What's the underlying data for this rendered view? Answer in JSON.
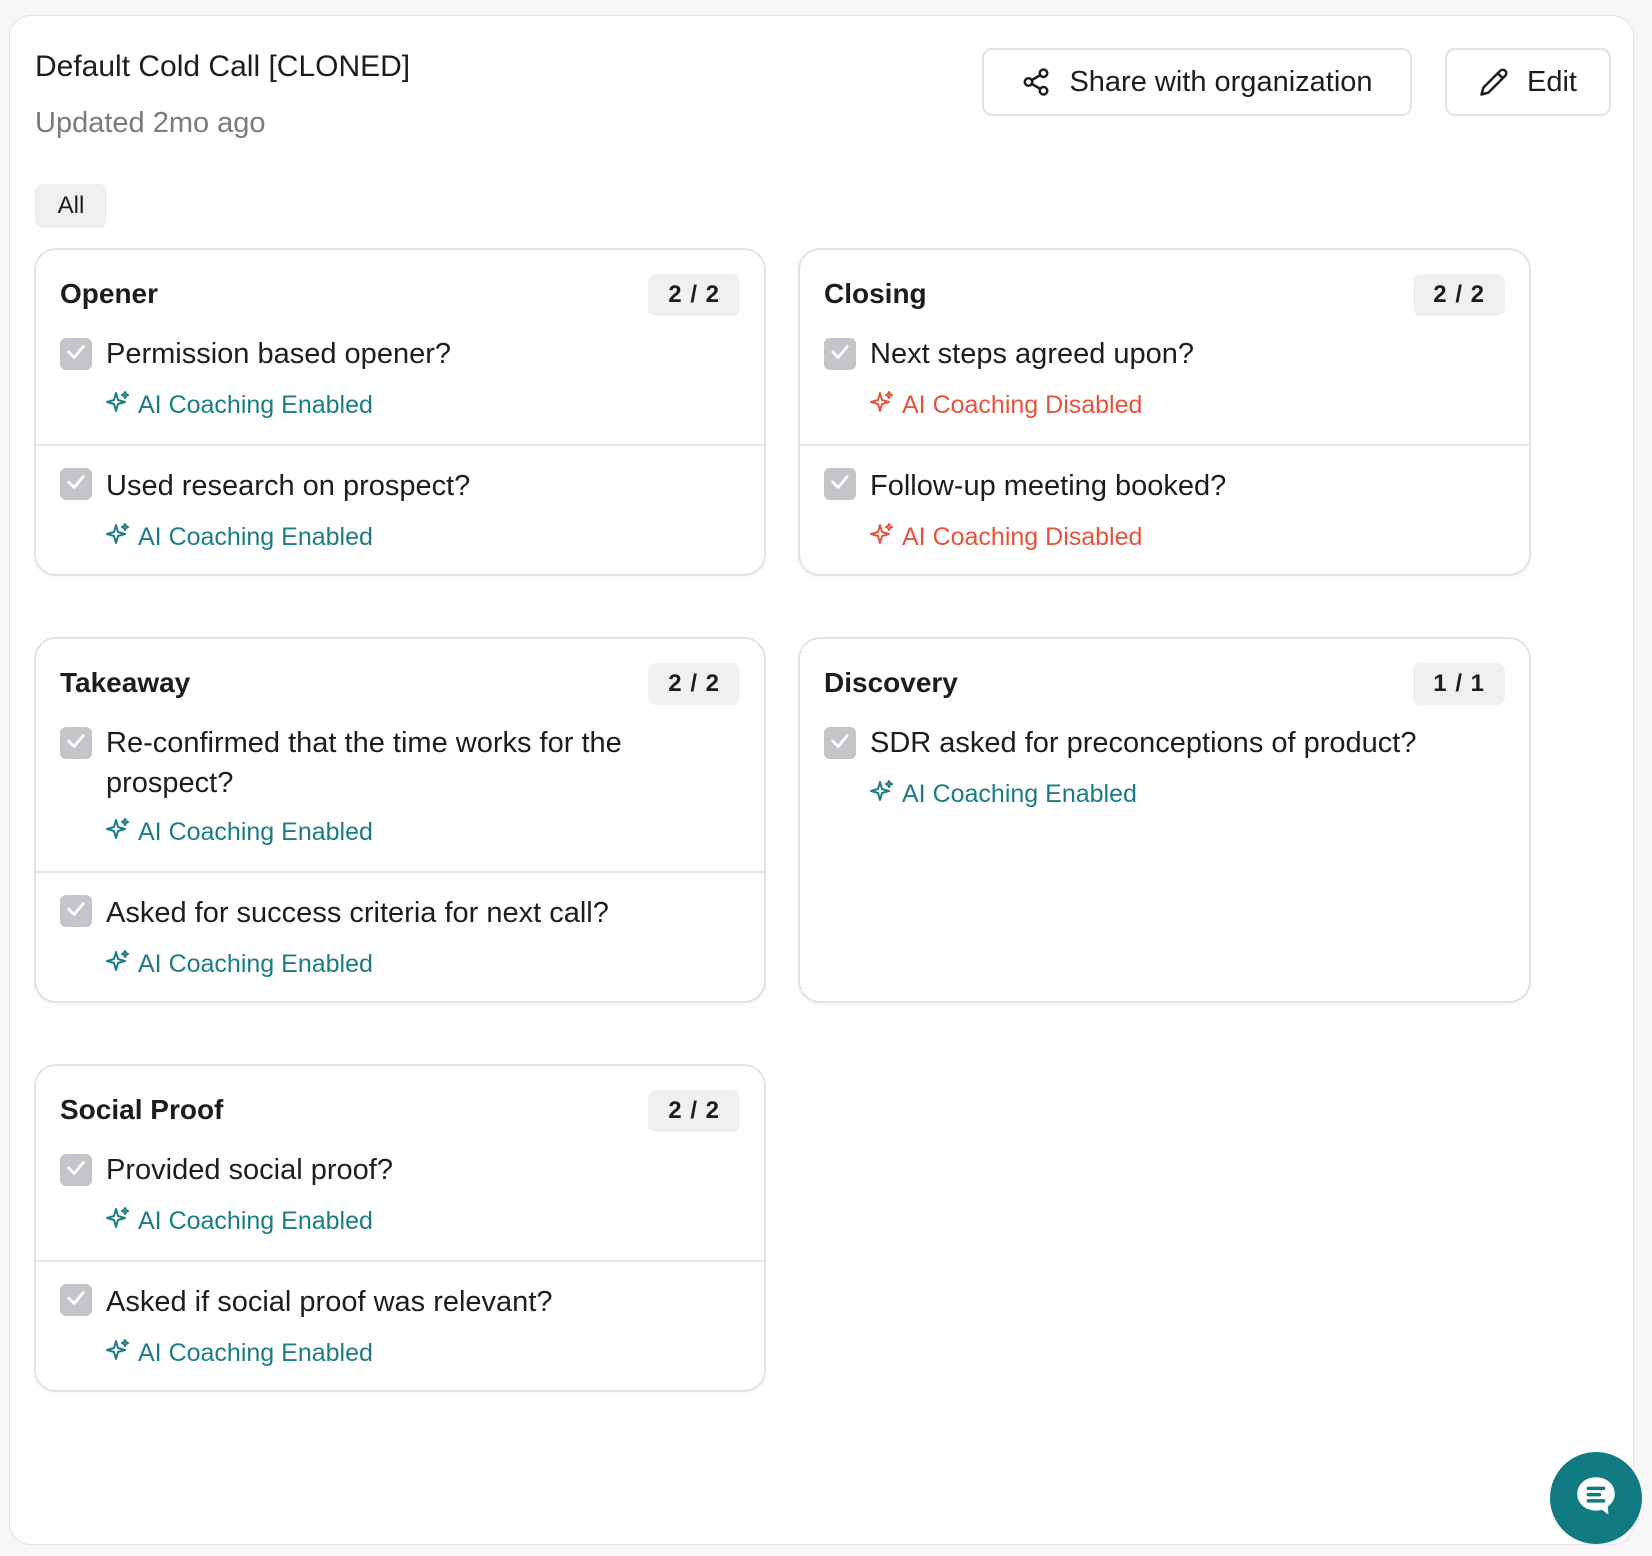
{
  "header": {
    "title": "Default Cold Call [CLONED]",
    "updated": "Updated 2mo ago",
    "share_label": "Share with organization",
    "edit_label": "Edit"
  },
  "filter": {
    "label": "All"
  },
  "colors": {
    "enabled": "#1a7d86",
    "disabled": "#e5533d",
    "checkbox": "#c4c4c9",
    "fab": "#127a82"
  },
  "cards": [
    {
      "title": "Opener",
      "count": "2 / 2",
      "items": [
        {
          "question": "Permission based opener?",
          "coaching": "AI Coaching Enabled",
          "status": "enabled"
        },
        {
          "question": "Used research on prospect?",
          "coaching": "AI Coaching Enabled",
          "status": "enabled"
        }
      ]
    },
    {
      "title": "Closing",
      "count": "2 / 2",
      "items": [
        {
          "question": "Next steps agreed upon?",
          "coaching": "AI Coaching Disabled",
          "status": "disabled"
        },
        {
          "question": "Follow-up meeting booked?",
          "coaching": "AI Coaching Disabled",
          "status": "disabled"
        }
      ]
    },
    {
      "title": "Takeaway",
      "count": "2 / 2",
      "items": [
        {
          "question": "Re-confirmed that the time works for the prospect?",
          "coaching": "AI Coaching Enabled",
          "status": "enabled"
        },
        {
          "question": "Asked for success criteria for next call?",
          "coaching": "AI Coaching Enabled",
          "status": "enabled"
        }
      ]
    },
    {
      "title": "Discovery",
      "count": "1 / 1",
      "items": [
        {
          "question": "SDR asked for preconceptions of product?",
          "coaching": "AI Coaching Enabled",
          "status": "enabled"
        }
      ]
    },
    {
      "title": "Social Proof",
      "count": "2 / 2",
      "items": [
        {
          "question": "Provided social proof?",
          "coaching": "AI Coaching Enabled",
          "status": "enabled"
        },
        {
          "question": "Asked if social proof was relevant?",
          "coaching": "AI Coaching Enabled",
          "status": "enabled"
        }
      ]
    }
  ]
}
